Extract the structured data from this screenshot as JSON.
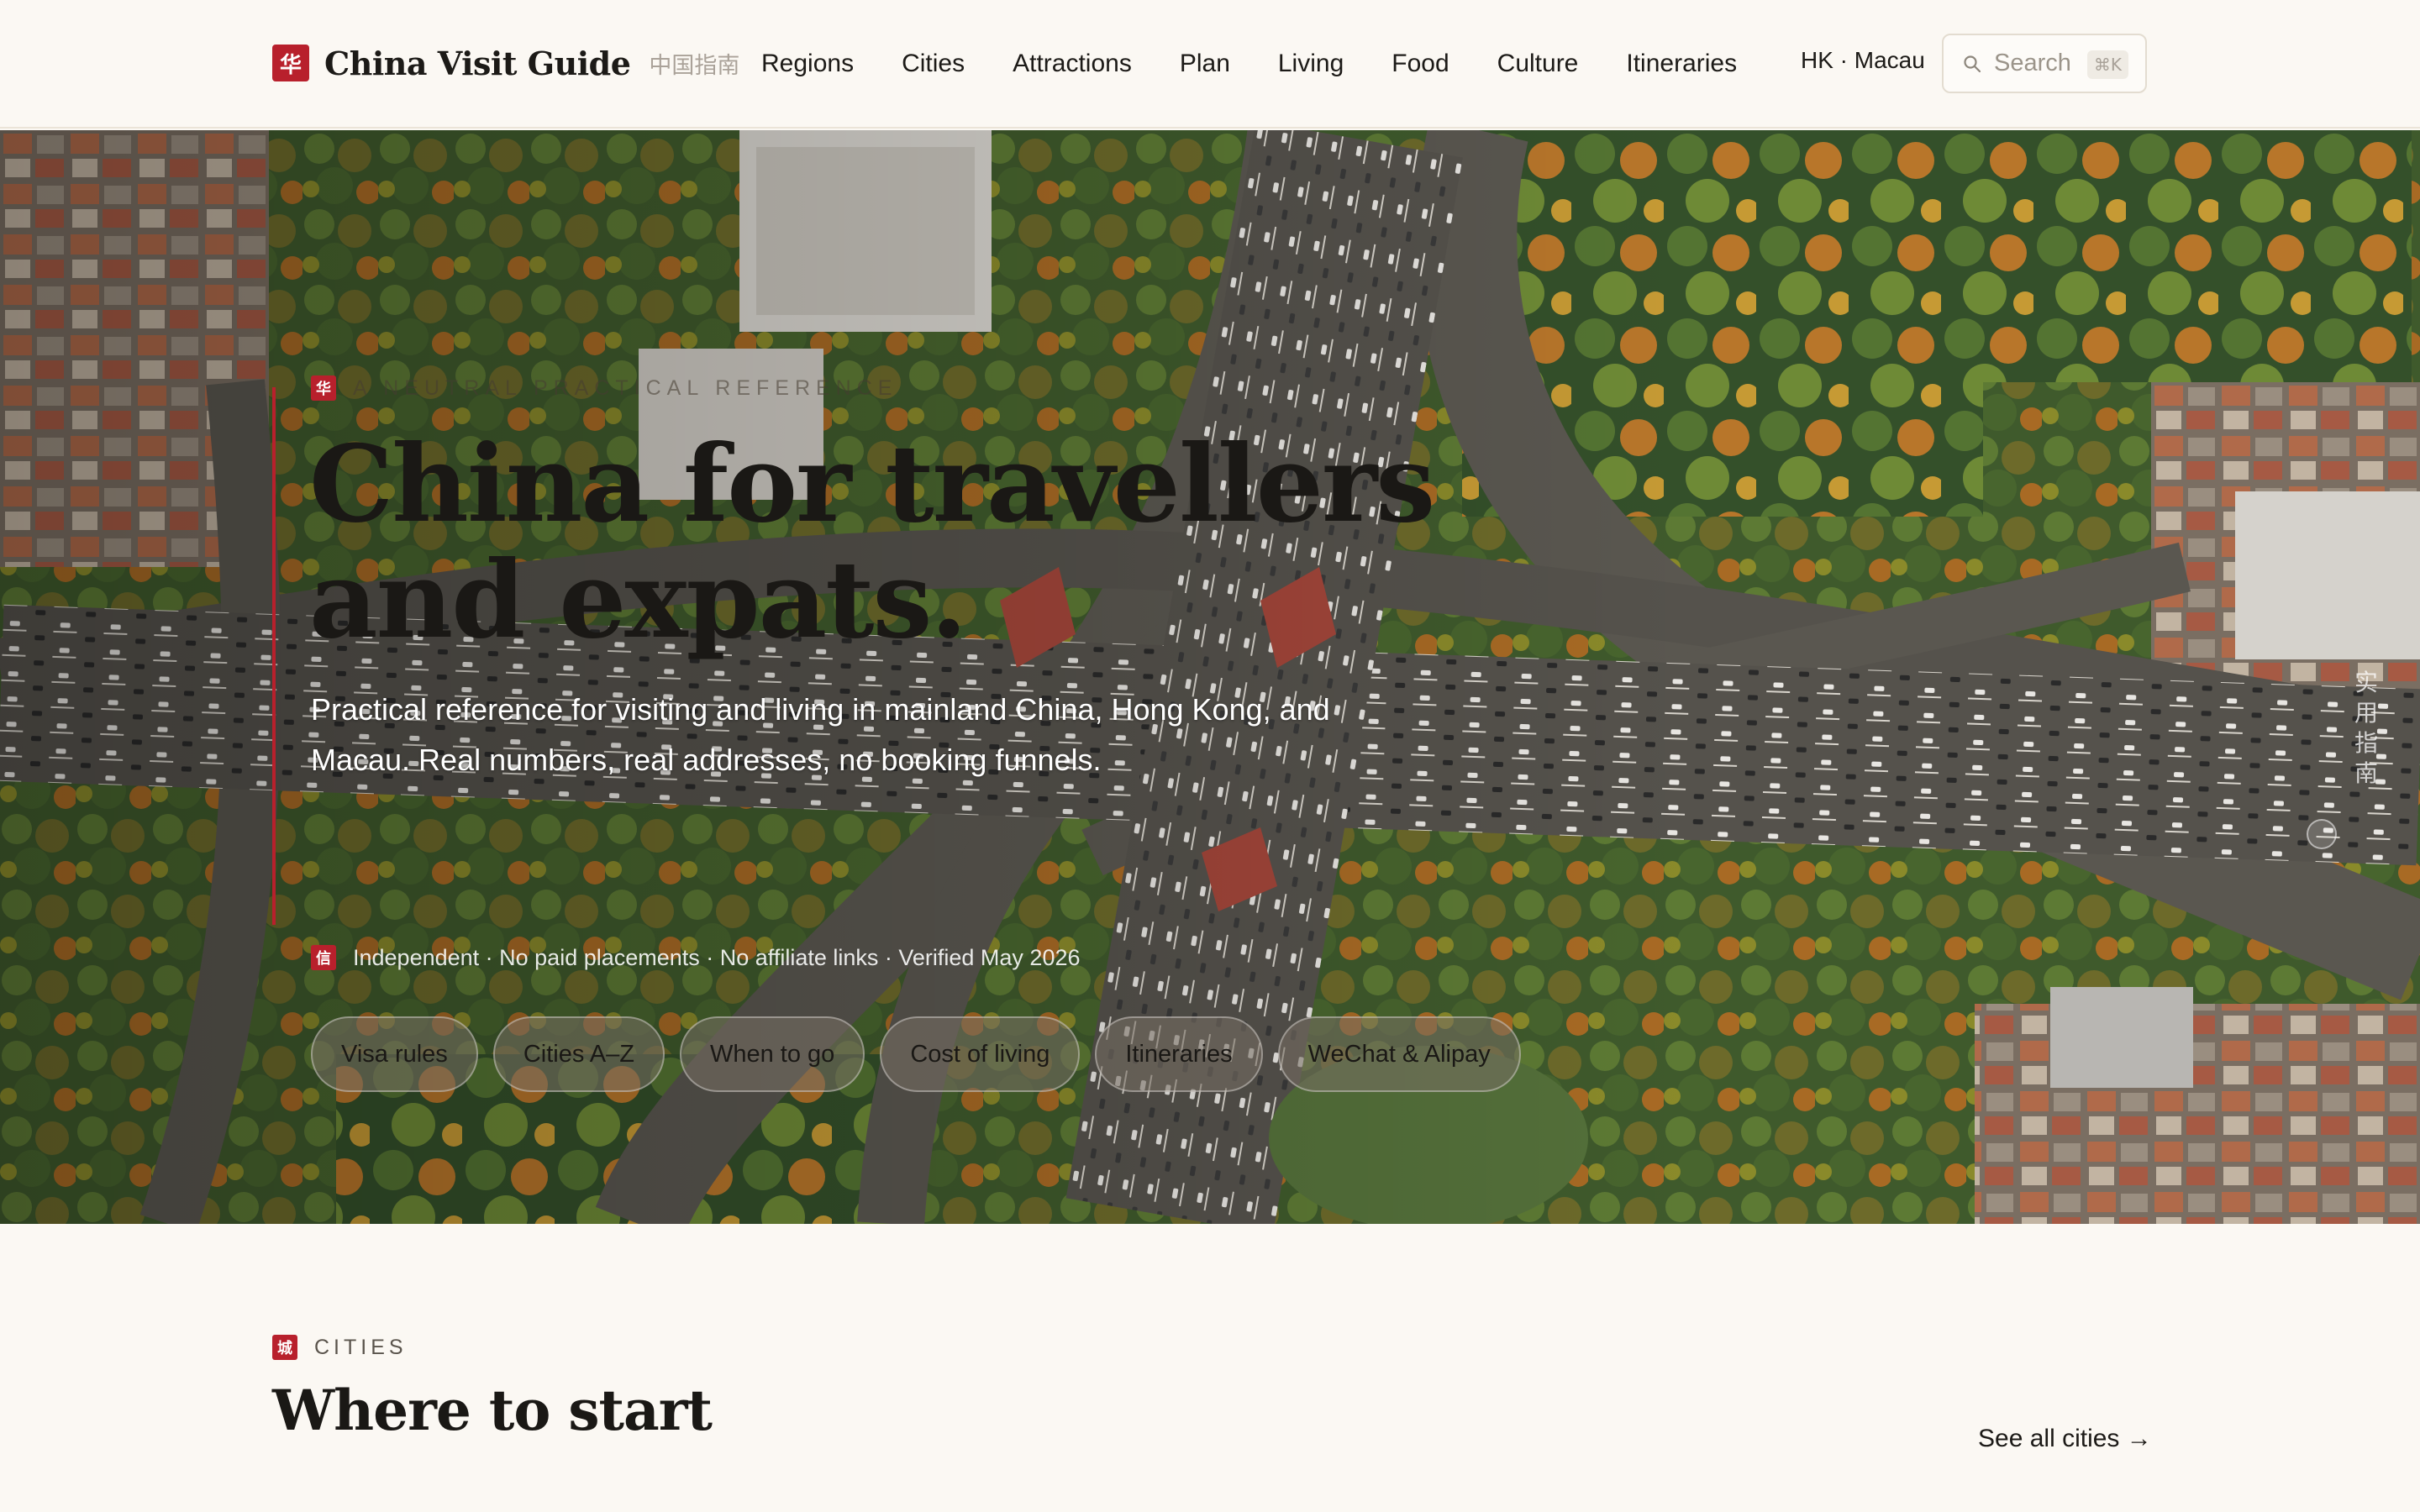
{
  "brand": {
    "seal": "华",
    "name": "China Visit Guide",
    "cn_name": "中国指南"
  },
  "nav": {
    "items": [
      {
        "label": "Regions"
      },
      {
        "label": "Cities"
      },
      {
        "label": "Attractions"
      },
      {
        "label": "Plan"
      },
      {
        "label": "Living"
      },
      {
        "label": "Food"
      },
      {
        "label": "Culture"
      },
      {
        "label": "Itineraries"
      }
    ],
    "region_link": "HK · Macau"
  },
  "search": {
    "placeholder": "Search",
    "shortcut": "⌘K"
  },
  "hero": {
    "eyebrow_seal": "华",
    "eyebrow": "A NEUTRAL PRACTICAL REFERENCE",
    "title": "China for travellers and expats.",
    "subtitle": "Practical reference for visiting and living in mainland China, Hong Kong, and Macau. Real numbers, real addresses, no booking funnels.",
    "trust_seal": "信",
    "trust": "Independent · No paid placements · No affiliate links · Verified May 2026",
    "chips": [
      "Visa rules",
      "Cities A–Z",
      "When to go",
      "Cost of living",
      "Itineraries",
      "WeChat & Alipay"
    ],
    "vertical_text": "实用指南"
  },
  "cities": {
    "seal": "城",
    "eyebrow": "CITIES",
    "title": "Where to start",
    "see_all": "See all cities →"
  },
  "colors": {
    "accent": "#b8202c",
    "background": "#fbf8f3",
    "text": "#1c1a17"
  }
}
